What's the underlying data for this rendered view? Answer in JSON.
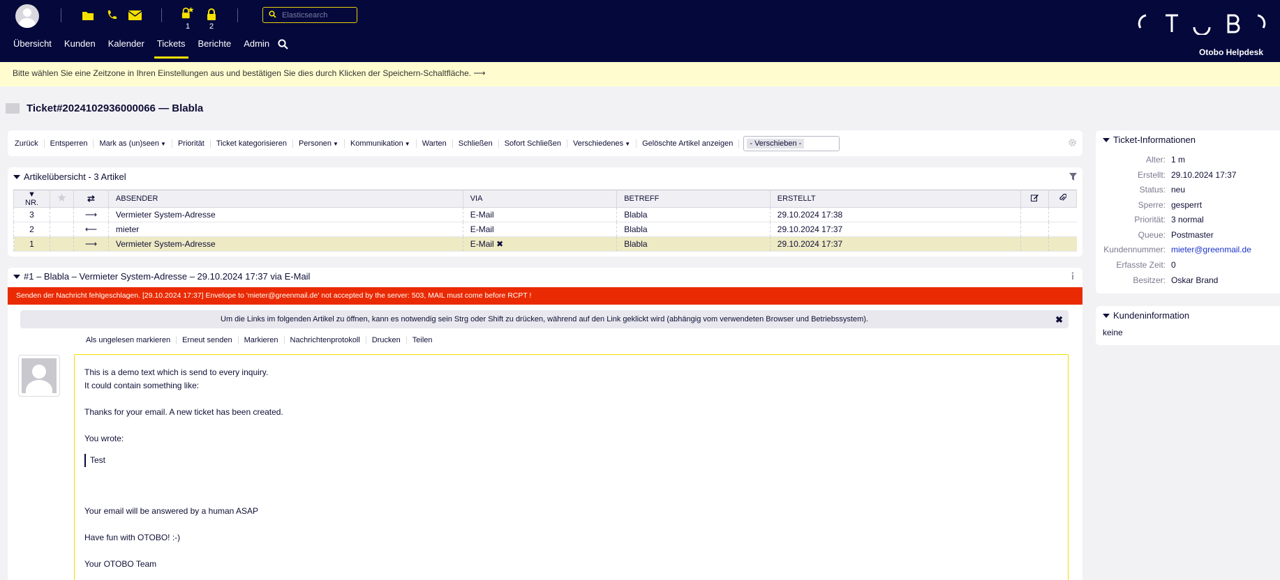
{
  "header": {
    "search_placeholder": "Elasticsearch",
    "locked_new_count": "1",
    "locked_count": "2",
    "nav": [
      "Übersicht",
      "Kunden",
      "Kalender",
      "Tickets",
      "Berichte",
      "Admin"
    ],
    "active_nav": "Tickets",
    "brand": "Otobo Helpdesk",
    "accent_color": "#f5e000",
    "bg_color": "#04083b"
  },
  "notice": "Bitte wählen Sie eine Zeitzone in Ihren Einstellungen aus und bestätigen Sie dies durch Klicken der Speichern-Schaltfläche. ⟶",
  "ticket": {
    "title": "Ticket#2024102936000066 — Blabla"
  },
  "actions": {
    "back": "Zurück",
    "unlock": "Entsperren",
    "mark_seen": "Mark as (un)seen",
    "priority": "Priorität",
    "categorize": "Ticket kategorisieren",
    "people": "Personen",
    "communication": "Kommunikation",
    "pending": "Warten",
    "close": "Schließen",
    "close_now": "Sofort Schließen",
    "misc": "Verschiedenes",
    "deleted": "Gelöschte Artikel anzeigen",
    "move": "- Verschieben -"
  },
  "overview": {
    "title": "Artikelübersicht - 3 Artikel",
    "columns": {
      "nr": "▼ NR.",
      "sender": "ABSENDER",
      "via": "VIA",
      "subject": "BETREFF",
      "created": "ERSTELLT"
    },
    "rows": [
      {
        "nr": "3",
        "direction": "⟶",
        "sender": "Vermieter System-Adresse",
        "via": "E-Mail",
        "subject": "Blabla",
        "created": "29.10.2024 17:38",
        "failed": ""
      },
      {
        "nr": "2",
        "direction": "⟵",
        "sender": "mieter",
        "via": "E-Mail",
        "subject": "Blabla",
        "created": "29.10.2024 17:37",
        "failed": ""
      },
      {
        "nr": "1",
        "direction": "⟶",
        "sender": "Vermieter System-Adresse",
        "via": "E-Mail",
        "subject": "Blabla",
        "created": "29.10.2024 17:37",
        "failed": "✖"
      }
    ]
  },
  "article": {
    "title": "#1 – Blabla – Vermieter System-Adresse – 29.10.2024 17:37 via E-Mail",
    "error": "Senden der Nachricht fehlgeschlagen. [29.10.2024 17:37] Envelope to 'mieter@greenmail.de' not accepted by the server: 503, MAIL must come before RCPT !",
    "hint": "Um die Links im folgenden Artikel zu öffnen, kann es notwendig sein Strg oder Shift zu drücken, während auf den Link geklickt wird (abhängig vom verwendeten Browser und Betriebssystem).",
    "menu": [
      "Als ungelesen markieren",
      "Erneut senden",
      "Markieren",
      "Nachrichtenprotokoll",
      "Drucken",
      "Teilen"
    ],
    "body": {
      "l1": "This is a demo text which is send to every inquiry.",
      "l2": "It could contain something like:",
      "l3": "Thanks for your email. A new ticket has been created.",
      "l4": "You wrote:",
      "quote": "Test",
      "l5": "Your email will be answered by a human ASAP",
      "l6": "Have fun with OTOBO! :-)",
      "l7": "Your OTOBO Team"
    }
  },
  "ticket_info": {
    "title": "Ticket-Informationen",
    "rows": [
      {
        "key": "Alter:",
        "value": "1 m"
      },
      {
        "key": "Erstellt:",
        "value": "29.10.2024 17:37"
      },
      {
        "key": "Status:",
        "value": "neu"
      },
      {
        "key": "Sperre:",
        "value": "gesperrt"
      },
      {
        "key": "Priorität:",
        "value": "3 normal"
      },
      {
        "key": "Queue:",
        "value": "Postmaster"
      },
      {
        "key": "Kundennummer:",
        "value": "mieter@greenmail.de"
      },
      {
        "key": "Erfasste Zeit:",
        "value": "0"
      },
      {
        "key": "Besitzer:",
        "value": "Oskar Brand"
      }
    ]
  },
  "customer_info": {
    "title": "Kundeninformation",
    "value": "keine"
  }
}
